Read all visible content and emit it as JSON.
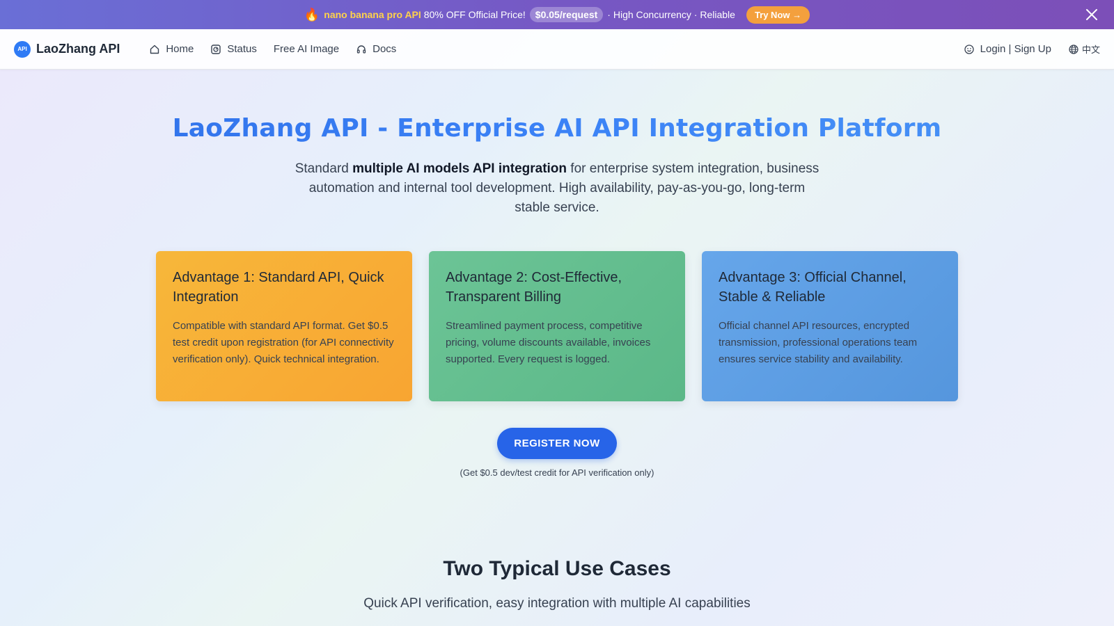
{
  "promo": {
    "fire_icon": "🔥",
    "highlight": "nano banana pro API",
    "text": "80% OFF Official Price!",
    "price": "$0.05/request",
    "tail": "· High Concurrency · Reliable",
    "cta": "Try Now →"
  },
  "nav": {
    "logo_text": "API",
    "brand": "LaoZhang API",
    "items": [
      {
        "label": "Home",
        "icon": "home-icon"
      },
      {
        "label": "Status",
        "icon": "status-icon"
      },
      {
        "label": "Free AI Image",
        "icon": ""
      },
      {
        "label": "Docs",
        "icon": "headset-icon"
      }
    ],
    "login": "Login | Sign Up",
    "language": "中文"
  },
  "hero": {
    "title": "LaoZhang API - Enterprise AI API Integration Platform",
    "sub_prefix": "Standard ",
    "sub_bold": "multiple AI models API integration",
    "sub_suffix": " for enterprise system integration, business automation and internal tool development. High availability, pay-as-you-go, long-term stable service."
  },
  "cards": [
    {
      "title": "Advantage 1: Standard API, Quick Integration",
      "body": "Compatible with standard API format. Get $0.5 test credit upon registration (for API connectivity verification only). Quick technical integration."
    },
    {
      "title": "Advantage 2: Cost-Effective, Transparent Billing",
      "body": "Streamlined payment process, competitive pricing, volume discounts available, invoices supported. Every request is logged."
    },
    {
      "title": "Advantage 3: Official Channel, Stable & Reliable",
      "body": "Official channel API resources, encrypted transmission, professional operations team ensures service stability and availability."
    }
  ],
  "register": {
    "button": "REGISTER NOW",
    "note": "(Get $0.5 dev/test credit for API verification only)"
  },
  "usecases": {
    "title": "Two Typical Use Cases",
    "subtitle": "Quick API verification, easy integration with multiple AI capabilities"
  },
  "colors": {
    "accent": "#2764e8",
    "card1": "#f7b73a",
    "card2": "#6cc496",
    "card3": "#66a6ea",
    "promo_cta": "#f4a03d"
  }
}
